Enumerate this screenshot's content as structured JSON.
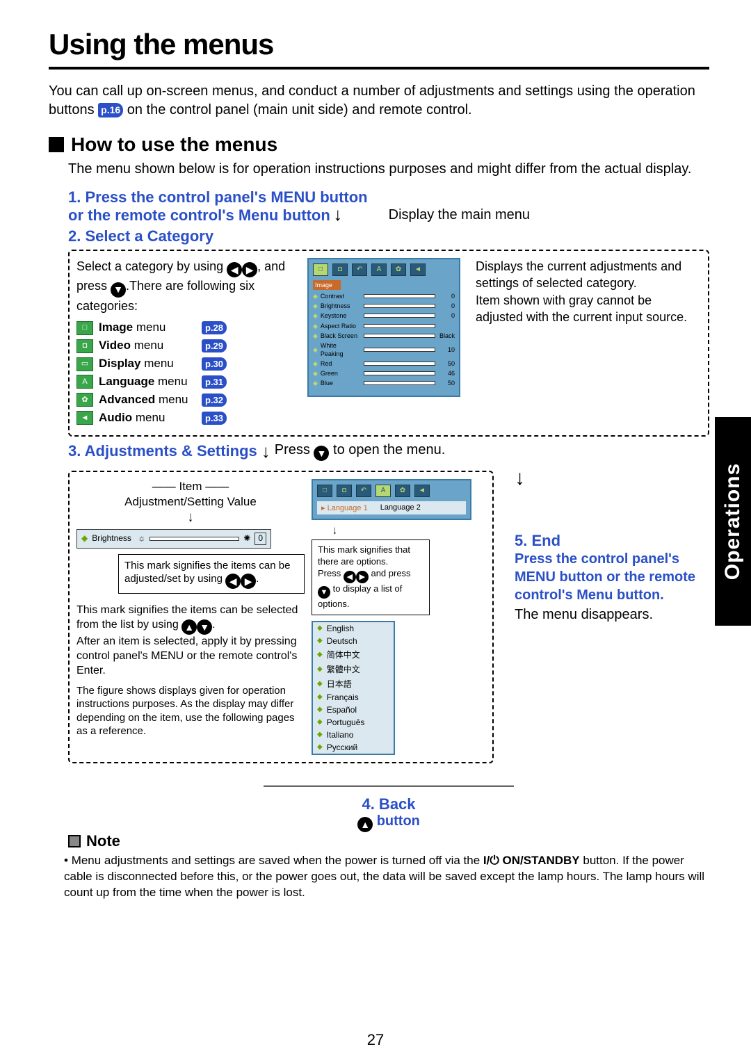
{
  "title": "Using the menus",
  "intro_a": "You can call up on-screen menus, and conduct a number of adjustments and settings using the operation buttons ",
  "intro_pref": "p.16",
  "intro_b": " on the control panel (main unit side) and remote control.",
  "section_title": "How to use the menus",
  "section_body": "The menu shown below is for operation instructions purposes and might differ from the actual display.",
  "step1_a": "1. Press the control panel's MENU button",
  "step1_b": "or the remote control's Menu button",
  "step1_side": "Display the main menu",
  "step2_title": "2. Select a Category",
  "step2_left_a": "Select a category by using ",
  "step2_left_b": ", and press ",
  "step2_left_c": ".There are following six categories:",
  "step2_right": "Displays the current adjustments and settings of selected category.\nItem shown with gray cannot be adjusted with the current input source.",
  "menus": [
    {
      "label_bold": "Image",
      "label_rest": " menu",
      "page": "p.28",
      "icon": "□"
    },
    {
      "label_bold": "Video",
      "label_rest": " menu",
      "page": "p.29",
      "icon": "◘"
    },
    {
      "label_bold": "Display",
      "label_rest": " menu",
      "page": "p.30",
      "icon": "▭"
    },
    {
      "label_bold": "Language",
      "label_rest": " menu",
      "page": "p.31",
      "icon": "A"
    },
    {
      "label_bold": "Advanced",
      "label_rest": " menu",
      "page": "p.32",
      "icon": "✿"
    },
    {
      "label_bold": "Audio",
      "label_rest": " menu",
      "page": "p.33",
      "icon": "◄"
    }
  ],
  "osd_head": "Image",
  "osd_items": [
    {
      "name": "Contrast",
      "val": "0"
    },
    {
      "name": "Brightness",
      "val": "0"
    },
    {
      "name": "Keystone",
      "val": "0"
    },
    {
      "name": "Aspect Ratio",
      "val": ""
    },
    {
      "name": "Black Screen",
      "val": "Black"
    },
    {
      "name": "White Peaking",
      "val": "10"
    },
    {
      "name": "Red",
      "val": "50"
    },
    {
      "name": "Green",
      "val": "46"
    },
    {
      "name": "Blue",
      "val": "50"
    }
  ],
  "step3_title": "3. Adjustments & Settings",
  "step3_side_a": "Press ",
  "step3_side_b": " to open the menu.",
  "item_label": "Item",
  "adj_label": "Adjustment/Setting Value",
  "brightness_name": "Brightness",
  "brightness_val": "0",
  "callout1": "This mark signifies the items can be adjusted/set by using ",
  "callout2_a": "This mark signifies that there are options.\nPress ",
  "callout2_b": " and press ",
  "callout2_c": " to display a list of options.",
  "lang1": "Language 1",
  "lang2": "Language 2",
  "list_note_a": "This mark signifies the items can be selected from the list by using ",
  "list_note_b": "After an item is selected, apply it by pressing control panel's MENU or the remote control's Enter.",
  "languages": [
    "English",
    "Deutsch",
    "简体中文",
    "繁體中文",
    "日本語",
    "Français",
    "Español",
    "Português",
    "Italiano",
    "Русский"
  ],
  "figure_note": "The figure shows displays given for operation instructions purposes. As the display may differ depending on the item, use the following pages as a reference.",
  "step4_title": "4. Back",
  "step4_sub": " button",
  "step5_title": "5. End",
  "step5_body": "Press the control panel's MENU button or the remote control's Menu  button.",
  "step5_after": "The menu disappears.",
  "note_title": "Note",
  "note_body_a": "Menu adjustments and settings are saved when the power is turned off via the ",
  "note_onstandby": "I/⏻ ON/STANDBY",
  "note_body_b": " button. If the power cable is disconnected before this, or the power goes out, the data will be saved except the lamp hours. The lamp hours will count up from the time when the power is lost.",
  "side_tab": "Operations",
  "page_number": "27"
}
